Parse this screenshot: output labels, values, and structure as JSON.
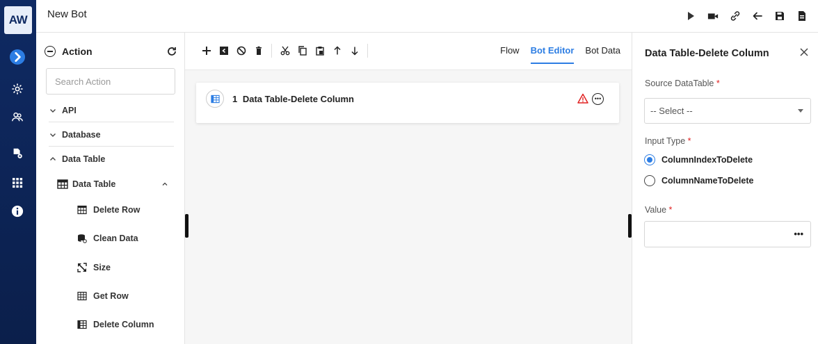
{
  "app": {
    "logo_text": "AW",
    "title": "New Bot"
  },
  "rail": {
    "icons": [
      "expand-icon",
      "settings-gear-icon",
      "users-icon",
      "bot-files-icon",
      "grid-icon",
      "info-icon"
    ]
  },
  "topbar": {
    "icons": [
      "play-icon",
      "record-icon",
      "link-icon",
      "back-arrow-icon",
      "save-icon",
      "export-icon"
    ]
  },
  "action_panel": {
    "title": "Action",
    "search_placeholder": "Search Action",
    "categories": [
      {
        "label": "API",
        "expanded": false
      },
      {
        "label": "Database",
        "expanded": false
      },
      {
        "label": "Data Table",
        "expanded": true
      }
    ],
    "subgroup": {
      "label": "Data Table"
    },
    "items": [
      {
        "label": "Delete Row",
        "icon": "delete-row-icon"
      },
      {
        "label": "Clean Data",
        "icon": "clean-data-icon"
      },
      {
        "label": "Size",
        "icon": "size-icon"
      },
      {
        "label": "Get Row",
        "icon": "get-row-icon"
      },
      {
        "label": "Delete Column",
        "icon": "delete-column-icon"
      }
    ]
  },
  "canvas": {
    "tabs": [
      {
        "label": "Flow",
        "active": false
      },
      {
        "label": "Bot Editor",
        "active": true
      },
      {
        "label": "Bot Data",
        "active": false
      }
    ],
    "node": {
      "number": "1",
      "label": "Data Table-Delete Column"
    }
  },
  "properties": {
    "title": "Data Table-Delete Column",
    "source_label": "Source DataTable",
    "required_mark": "*",
    "source_value": "-- Select --",
    "input_type_label": "Input Type",
    "input_options": [
      {
        "label": "ColumnIndexToDelete",
        "selected": true
      },
      {
        "label": "ColumnNameToDelete",
        "selected": false
      }
    ],
    "value_label": "Value",
    "value_more": "•••"
  },
  "colors": {
    "rail": "#0f2a63",
    "accent": "#2c7de3",
    "warning": "#e02020"
  }
}
